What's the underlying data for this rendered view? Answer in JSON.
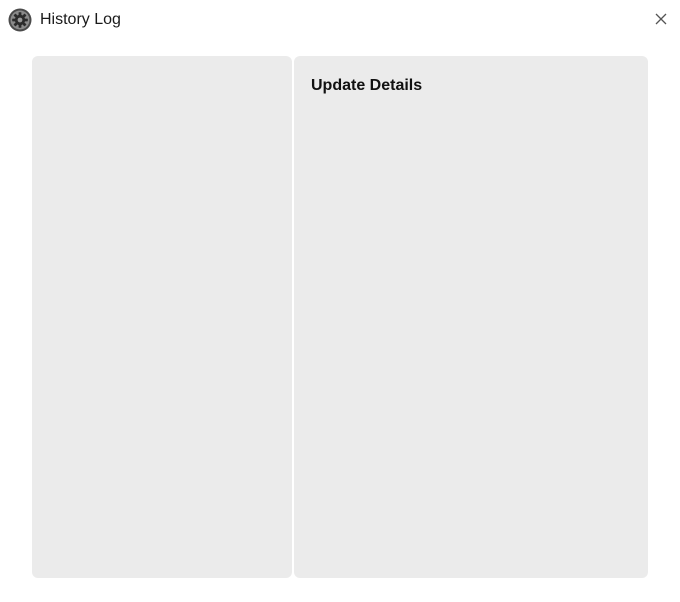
{
  "window": {
    "title": "History Log",
    "app_icon": "gear-icon",
    "close_icon": "close-icon"
  },
  "details_panel": {
    "heading": "Update Details"
  },
  "colors": {
    "window_bg": "#ffffff",
    "panel_bg": "#ebebeb",
    "title_text": "#1a1a1a"
  }
}
